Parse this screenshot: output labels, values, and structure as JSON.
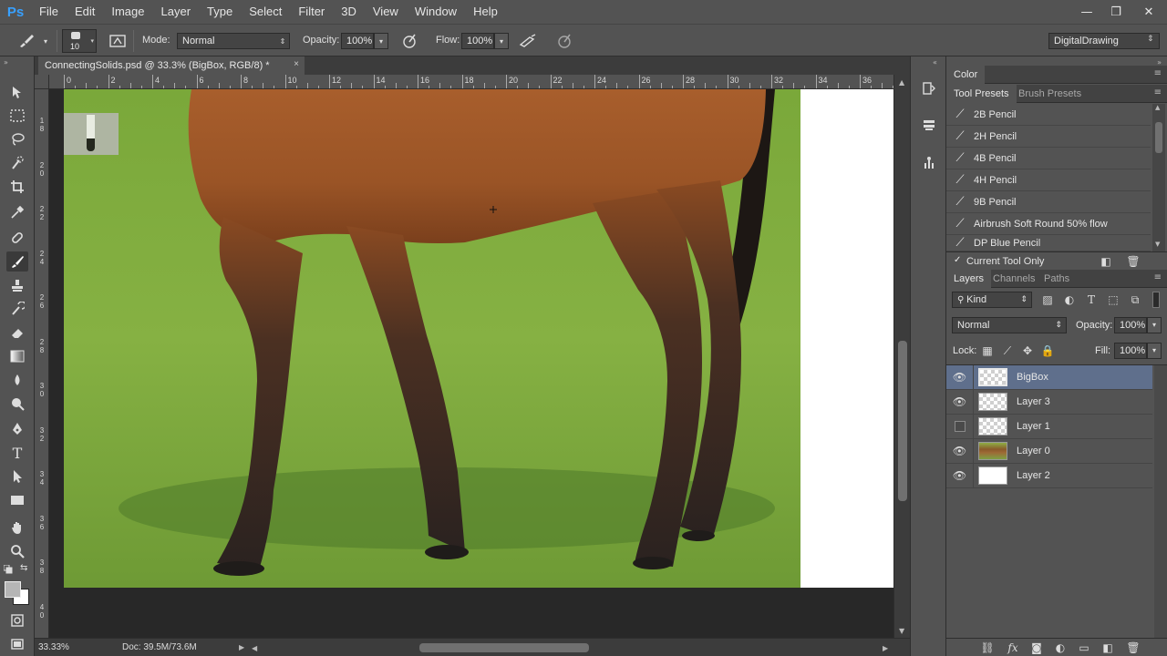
{
  "app": {
    "logo": "Ps"
  },
  "menu": [
    "File",
    "Edit",
    "Image",
    "Layer",
    "Type",
    "Select",
    "Filter",
    "3D",
    "View",
    "Window",
    "Help"
  ],
  "window_controls": {
    "minimize": "—",
    "restore": "❐",
    "close": "✕"
  },
  "options": {
    "brush_size": "10",
    "mode_label": "Mode:",
    "mode_value": "Normal",
    "opacity_label": "Opacity:",
    "opacity_value": "100%",
    "flow_label": "Flow:",
    "flow_value": "100%",
    "workspace": "DigitalDrawing"
  },
  "document": {
    "tab_title": "ConnectingSolids.psd @ 33.3% (BigBox, RGB/8) *",
    "close": "×",
    "zoom": "33.33%",
    "doc_size": "Doc: 39.5M/73.6M"
  },
  "ruler": {
    "top": [
      "0",
      "2",
      "4",
      "6",
      "8",
      "10",
      "12",
      "14",
      "16",
      "18",
      "20",
      "22",
      "24",
      "26",
      "28",
      "30",
      "32",
      "34",
      "36"
    ],
    "left": [
      "1\n8",
      "2\n0",
      "2\n2",
      "2\n4",
      "2\n6",
      "2\n8",
      "3\n0",
      "3\n2",
      "3\n4",
      "3\n6",
      "3\n8",
      "4\n0"
    ]
  },
  "panels": {
    "color_tab": "Color",
    "tool_presets_tab": "Tool Presets",
    "brush_presets_tab": "Brush Presets",
    "presets": [
      "2B Pencil",
      "2H Pencil",
      "4B Pencil",
      "4H Pencil",
      "9B Pencil",
      "Airbrush Soft Round 50% flow",
      "DP Blue Pencil"
    ],
    "current_tool_only": "Current Tool Only",
    "layers_tab": "Layers",
    "channels_tab": "Channels",
    "paths_tab": "Paths",
    "kind_filter": "Kind",
    "blend_mode": "Normal",
    "opacity_label": "Opacity:",
    "opacity_value": "100%",
    "lock_label": "Lock:",
    "fill_label": "Fill:",
    "fill_value": "100%",
    "layers": [
      {
        "name": "BigBox",
        "visible": true,
        "selected": true
      },
      {
        "name": "Layer 3",
        "visible": true,
        "selected": false
      },
      {
        "name": "Layer 1",
        "visible": false,
        "selected": false
      },
      {
        "name": "Layer 0",
        "visible": true,
        "selected": false
      },
      {
        "name": "Layer 2",
        "visible": true,
        "selected": false
      }
    ]
  }
}
